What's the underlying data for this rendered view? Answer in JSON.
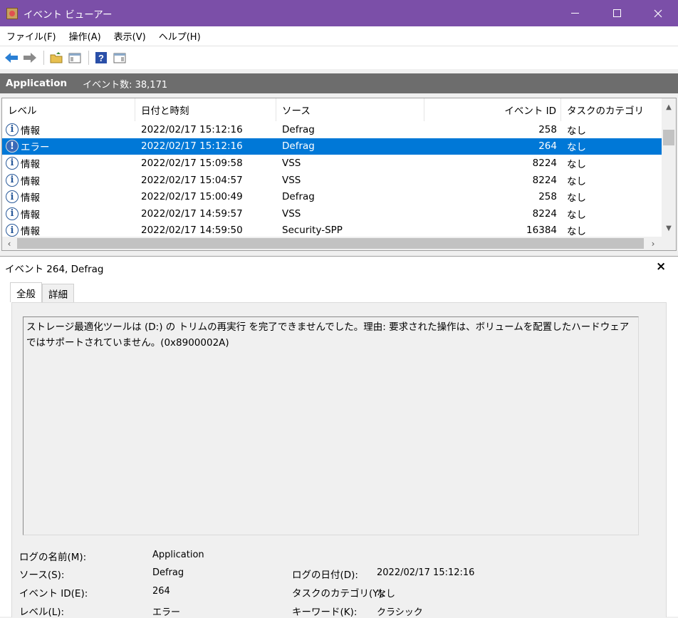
{
  "window": {
    "title": "イベント ビューアー",
    "colors": {
      "titlebar": "#7b4fa8",
      "selection": "#0078d7",
      "header_strip": "#6d6d6d"
    }
  },
  "menu": [
    "ファイル(F)",
    "操作(A)",
    "表示(V)",
    "ヘルプ(H)"
  ],
  "toolbar": {
    "icons": [
      "back-arrow-icon",
      "forward-arrow-icon",
      "up-folder-icon",
      "show-hide-tree-icon",
      "help-icon",
      "action-pane-icon"
    ]
  },
  "log_header": {
    "name": "Application",
    "count": "イベント数: 38,171"
  },
  "grid": {
    "columns": [
      "レベル",
      "日付と時刻",
      "ソース",
      "イベント ID",
      "タスクのカテゴリ"
    ],
    "rows": [
      {
        "level": "情報",
        "date": "2022/02/17 15:12:16",
        "source": "Defrag",
        "id": "258",
        "task": "なし",
        "icon": "info-icon"
      },
      {
        "level": "エラー",
        "date": "2022/02/17 15:12:16",
        "source": "Defrag",
        "id": "264",
        "task": "なし",
        "icon": "error-icon",
        "selected": true
      },
      {
        "level": "情報",
        "date": "2022/02/17 15:09:58",
        "source": "VSS",
        "id": "8224",
        "task": "なし",
        "icon": "info-icon"
      },
      {
        "level": "情報",
        "date": "2022/02/17 15:04:57",
        "source": "VSS",
        "id": "8224",
        "task": "なし",
        "icon": "info-icon"
      },
      {
        "level": "情報",
        "date": "2022/02/17 15:00:49",
        "source": "Defrag",
        "id": "258",
        "task": "なし",
        "icon": "info-icon"
      },
      {
        "level": "情報",
        "date": "2022/02/17 14:59:57",
        "source": "VSS",
        "id": "8224",
        "task": "なし",
        "icon": "info-icon"
      },
      {
        "level": "情報",
        "date": "2022/02/17 14:59:50",
        "source": "Security-SPP",
        "id": "16384",
        "task": "なし",
        "icon": "info-icon"
      }
    ]
  },
  "detail": {
    "title": "イベント 264, Defrag",
    "close": "×",
    "tabs": [
      "全般",
      "詳細"
    ],
    "message": "ストレージ最適化ツールは (D:) の トリムの再実行 を完了できませんでした。理由: 要求された操作は、ボリュームを配置したハードウェアではサポートされていません。(0x8900002A)",
    "props": {
      "log_name_label": "ログの名前(M):",
      "log_name": "Application",
      "source_label": "ソース(S):",
      "source": "Defrag",
      "logged_label": "ログの日付(D):",
      "logged": "2022/02/17 15:12:16",
      "event_id_label": "イベント ID(E):",
      "event_id": "264",
      "task_label": "タスクのカテゴリ(Y):",
      "task": "なし",
      "level_label": "レベル(L):",
      "level": "エラー",
      "keywords_label": "キーワード(K):",
      "keywords": "クラシック"
    }
  }
}
